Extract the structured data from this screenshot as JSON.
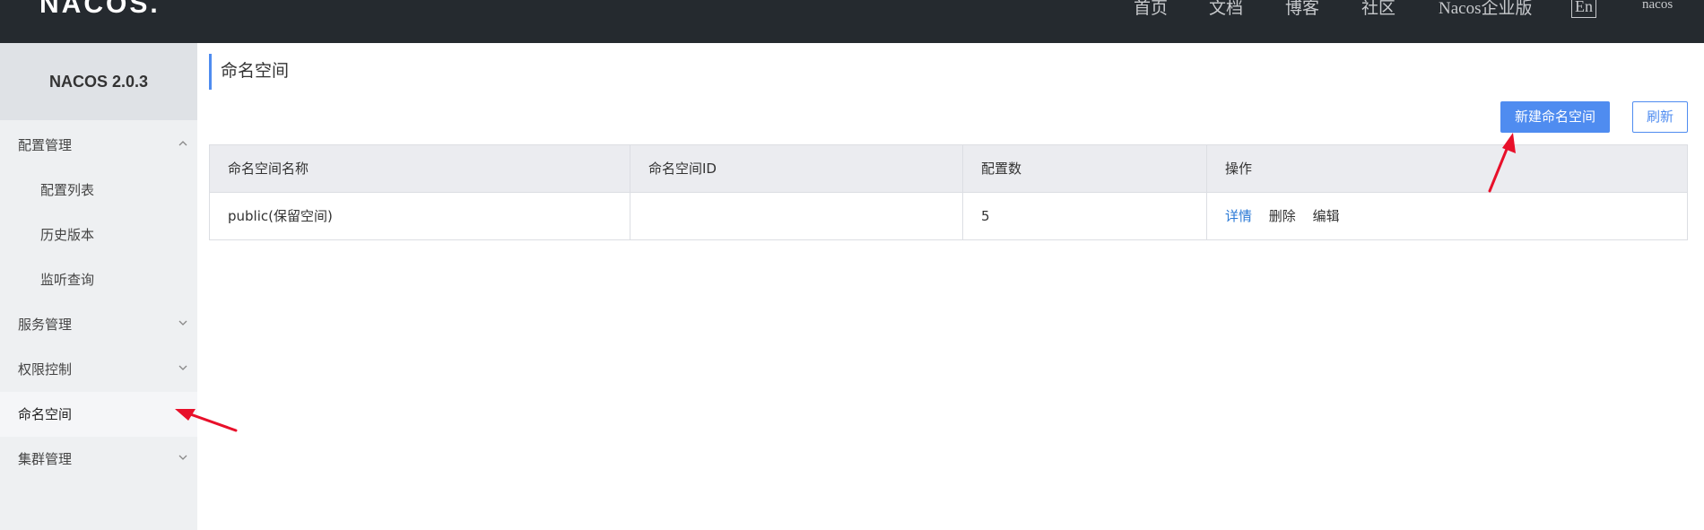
{
  "header": {
    "logo": "NACOS.",
    "nav": [
      "首页",
      "文档",
      "博客",
      "社区",
      "Nacos企业版"
    ],
    "lang_button": "En",
    "user": "nacos"
  },
  "sidebar": {
    "product_title": "NACOS 2.0.3",
    "items": [
      {
        "label": "配置管理",
        "chevron": "chevron-up-icon"
      },
      {
        "label": "配置列表"
      },
      {
        "label": "历史版本"
      },
      {
        "label": "监听查询"
      },
      {
        "label": "服务管理",
        "chevron": "chevron-down-icon"
      },
      {
        "label": "权限控制",
        "chevron": "chevron-down-icon"
      },
      {
        "label": "命名空间",
        "active": true
      },
      {
        "label": "集群管理",
        "chevron": "chevron-down-icon"
      }
    ]
  },
  "main": {
    "title": "命名空间",
    "buttons": {
      "create": "新建命名空间",
      "refresh": "刷新"
    },
    "table": {
      "columns": [
        "命名空间名称",
        "命名空间ID",
        "配置数",
        "操作"
      ],
      "rows": [
        {
          "name": "public(保留空间)",
          "id": "",
          "count": "5",
          "actions": [
            "详情",
            "删除",
            "编辑"
          ]
        }
      ]
    }
  },
  "colors": {
    "topbar": "#252a2f",
    "accent": "#4f8cf0",
    "annotation_arrow": "#e8102a"
  }
}
